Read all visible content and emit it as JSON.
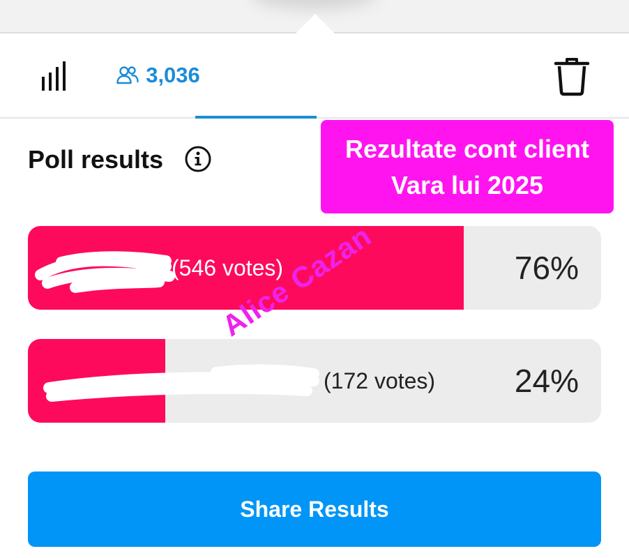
{
  "header": {
    "tabs": [
      {
        "id": "stats",
        "icon": "bar-chart-icon"
      },
      {
        "id": "voters",
        "icon": "people-icon",
        "count": "3,036",
        "active": true
      }
    ],
    "trash_icon": "trash-icon"
  },
  "poll": {
    "title": "Poll results",
    "info_icon": "info-icon",
    "overlay_label": [
      "Rezultate cont client",
      "Vara lui 2025"
    ],
    "options": [
      {
        "votes_label": "(546 votes)",
        "percent_label": "76%",
        "percent": 76
      },
      {
        "votes_label": "(172 votes)",
        "percent_label": "24%",
        "percent": 24
      }
    ]
  },
  "watermark": "Alice Cazan",
  "footer": {
    "share_label": "Share Results"
  },
  "colors": {
    "accent": "#1a8cd8",
    "bar_fill": "#fe0a5c",
    "bar_track": "#ececec",
    "overlay": "#ff14f0",
    "button": "#0095f6"
  }
}
